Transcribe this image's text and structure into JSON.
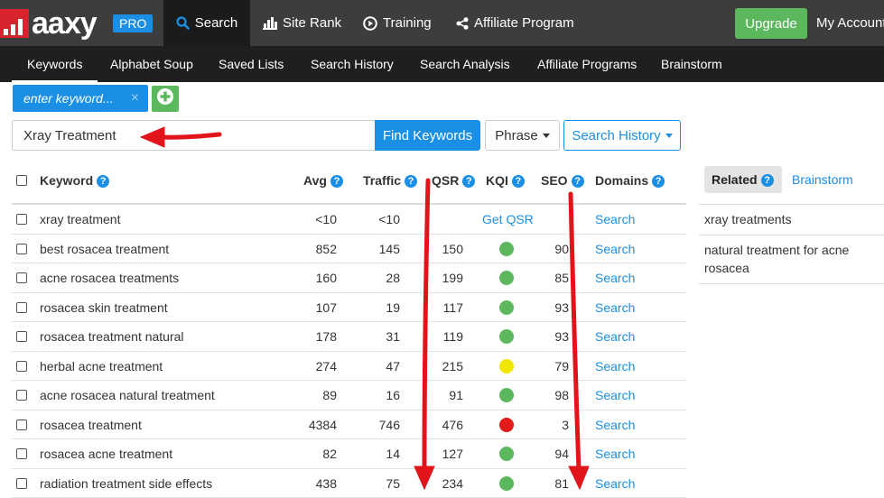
{
  "brand": {
    "logo_text": "aaxy",
    "pro_label": "PRO"
  },
  "topnav": [
    {
      "label": "Search",
      "icon": "search-icon"
    },
    {
      "label": "Site Rank",
      "icon": "bar-chart-icon"
    },
    {
      "label": "Training",
      "icon": "play-circle-icon"
    },
    {
      "label": "Affiliate Program",
      "icon": "share-icon"
    }
  ],
  "upgrade_label": "Upgrade",
  "account_label": "My Account",
  "subnav": [
    "Keywords",
    "Alphabet Soup",
    "Saved Lists",
    "Search History",
    "Search Analysis",
    "Affiliate Programs",
    "Brainstorm"
  ],
  "keyword_tag": {
    "placeholder": "enter keyword...",
    "close": "×"
  },
  "search": {
    "value": "Xray Treatment",
    "find_label": "Find Keywords",
    "phrase_label": "Phrase",
    "history_label": "Search History"
  },
  "table": {
    "headers": {
      "keyword": "Keyword",
      "avg": "Avg",
      "traffic": "Traffic",
      "qsr": "QSR",
      "kqi": "KQI",
      "seo": "SEO",
      "domains": "Domains"
    },
    "rows": [
      {
        "keyword": "xray treatment",
        "avg": "<10",
        "traffic": "<10",
        "qsr": "",
        "kqi": "none",
        "kqi_text": "Get QSR",
        "seo": "",
        "domains": "Search"
      },
      {
        "keyword": "best rosacea treatment",
        "avg": "852",
        "traffic": "145",
        "qsr": "150",
        "kqi": "green",
        "seo": "90",
        "domains": "Search"
      },
      {
        "keyword": "acne rosacea treatments",
        "avg": "160",
        "traffic": "28",
        "qsr": "199",
        "kqi": "green",
        "seo": "85",
        "domains": "Search"
      },
      {
        "keyword": "rosacea skin treatment",
        "avg": "107",
        "traffic": "19",
        "qsr": "117",
        "kqi": "green",
        "seo": "93",
        "domains": "Search"
      },
      {
        "keyword": "rosacea treatment natural",
        "avg": "178",
        "traffic": "31",
        "qsr": "119",
        "kqi": "green",
        "seo": "93",
        "domains": "Search"
      },
      {
        "keyword": "herbal acne treatment",
        "avg": "274",
        "traffic": "47",
        "qsr": "215",
        "kqi": "yellow",
        "seo": "79",
        "domains": "Search"
      },
      {
        "keyword": "acne rosacea natural treatment",
        "avg": "89",
        "traffic": "16",
        "qsr": "91",
        "kqi": "green",
        "seo": "98",
        "domains": "Search"
      },
      {
        "keyword": "rosacea treatment",
        "avg": "4384",
        "traffic": "746",
        "qsr": "476",
        "kqi": "red",
        "seo": "3",
        "domains": "Search"
      },
      {
        "keyword": "rosacea acne treatment",
        "avg": "82",
        "traffic": "14",
        "qsr": "127",
        "kqi": "green",
        "seo": "94",
        "domains": "Search"
      },
      {
        "keyword": "radiation treatment side effects",
        "avg": "438",
        "traffic": "75",
        "qsr": "234",
        "kqi": "green",
        "seo": "81",
        "domains": "Search"
      }
    ]
  },
  "related_panel": {
    "tab_related": "Related",
    "tab_brainstorm": "Brainstorm",
    "items": [
      "xray treatments",
      "natural treatment for acne rosacea"
    ]
  },
  "colors": {
    "accent": "#1a8fe3",
    "green": "#5cb85c",
    "yellow": "#f2e600",
    "red": "#e31b1b",
    "brand_red": "#d9232e",
    "annotation": "#e0141a"
  }
}
